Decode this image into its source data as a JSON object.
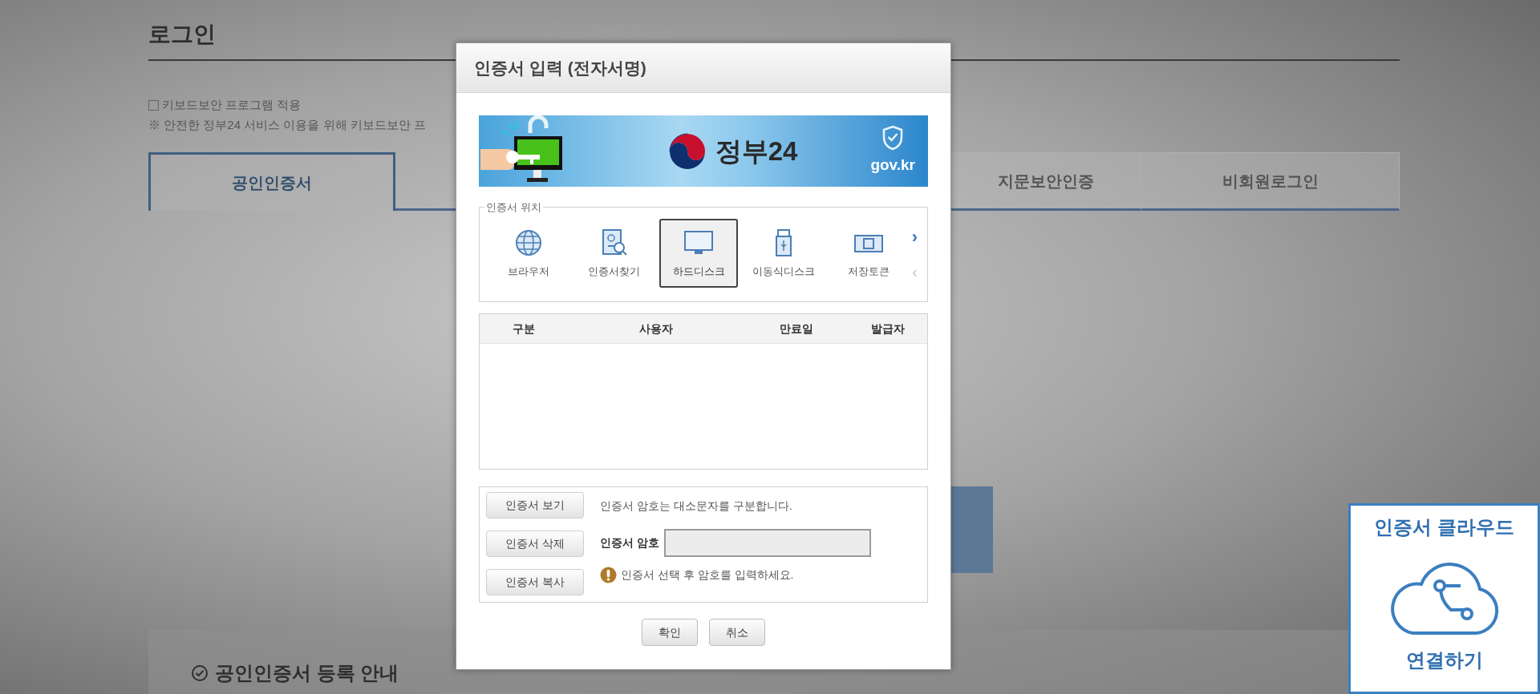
{
  "page": {
    "title": "로그인",
    "keyboard_security": {
      "label": "키보드보안 프로그램 적용",
      "checked": false
    },
    "notice": "※ 안전한 정부24 서비스 이용을 위해 키보드보안 프",
    "tabs": [
      {
        "label": "공인인증서",
        "selected": true
      },
      {
        "label": "지문보안인증",
        "selected": false
      },
      {
        "label": "비회원로그인",
        "selected": false
      }
    ],
    "guide": "공인인증서 등록 안내"
  },
  "dialog": {
    "title": "인증서 입력 (전자서명)",
    "banner": {
      "logo": "정부24",
      "domain": "gov.kr"
    },
    "location": {
      "legend": "인증서 위치",
      "next": "›",
      "prev": "‹",
      "items": [
        {
          "kind": "browser",
          "label": "브라우저",
          "selected": false
        },
        {
          "kind": "search",
          "label": "인증서찾기",
          "selected": false
        },
        {
          "kind": "harddisk",
          "label": "하드디스크",
          "selected": true
        },
        {
          "kind": "removable",
          "label": "이동식디스크",
          "selected": false
        },
        {
          "kind": "token",
          "label": "저장토큰",
          "selected": false
        }
      ]
    },
    "table": {
      "columns": [
        "구분",
        "사용자",
        "만료일",
        "발급자"
      ]
    },
    "actions": [
      "인증서 보기",
      "인증서 삭제",
      "인증서 복사"
    ],
    "hint": "인증서 암호는 대소문자를 구분합니다.",
    "password": {
      "label": "인증서 암호"
    },
    "warning": "인증서 선택 후 암호를 입력하세요.",
    "buttons": [
      "확인",
      "취소"
    ]
  },
  "cloud": {
    "title": "인증서 클라우드",
    "action": "연결하기"
  }
}
